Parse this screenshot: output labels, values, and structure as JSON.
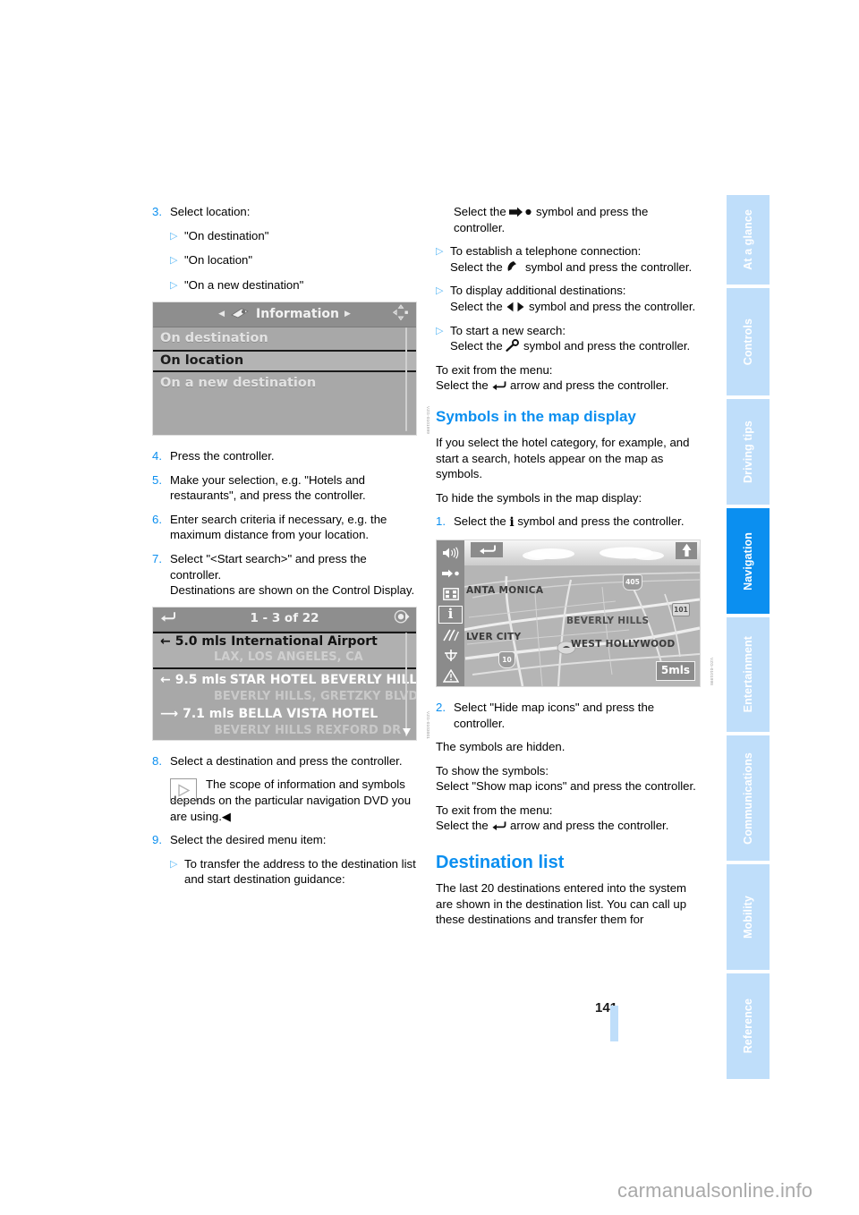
{
  "document": {
    "page_number": "141",
    "watermark": "carmanualsonline.info"
  },
  "sidebar": {
    "tabs": [
      {
        "label": "At a glance",
        "active": false
      },
      {
        "label": "Controls",
        "active": false
      },
      {
        "label": "Driving tips",
        "active": false
      },
      {
        "label": "Navigation",
        "active": true
      },
      {
        "label": "Entertainment",
        "active": false
      },
      {
        "label": "Communications",
        "active": false
      },
      {
        "label": "Mobility",
        "active": false
      },
      {
        "label": "Reference",
        "active": false
      }
    ]
  },
  "left_column": {
    "step3": {
      "num": "3.",
      "text": "Select location:",
      "bullets": [
        "\"On destination\"",
        "\"On location\"",
        "\"On a new destination\""
      ]
    },
    "figure_information": {
      "caption": "VZG-0101999",
      "header_title": "Information",
      "rows": [
        {
          "label": "On destination",
          "selected": false
        },
        {
          "label": "On location",
          "selected": true
        },
        {
          "label": "On a new destination",
          "selected": false
        }
      ]
    },
    "step4": {
      "num": "4.",
      "text": "Press the controller."
    },
    "step5": {
      "num": "5.",
      "text": "Make your selection, e.g. \"Hotels and restaurants\", and press the controller."
    },
    "step6": {
      "num": "6.",
      "text": "Enter search criteria if necessary, e.g. the maximum distance from your location."
    },
    "step7": {
      "num": "7.",
      "text": "Select \"<Start search>\" and press the controller.",
      "text2": "Destinations are shown on the Control Display."
    },
    "figure_destinations": {
      "caption": "VZG-0103001",
      "header_title": "1 - 3 of 22",
      "items": [
        {
          "dir": "left",
          "distance": "5.0 mls",
          "name": "International Airport",
          "address": "LAX, LOS ANGELES, CA",
          "selected": true
        },
        {
          "dir": "left",
          "distance": "9.5 mls",
          "name": "STAR HOTEL BEVERLY HILLS",
          "address": "BEVERLY HILLS, GRETZKY BLVD",
          "selected": false
        },
        {
          "dir": "right",
          "distance": "7.1 mls",
          "name": "BELLA VISTA HOTEL",
          "address": "BEVERLY HILLS REXFORD DR",
          "selected": false
        }
      ]
    },
    "step8": {
      "num": "8.",
      "text": "Select a destination and press the controller."
    },
    "note": {
      "text": "The scope of information and symbols depends on the particular navigation DVD you are using.",
      "end_mark": "◀"
    },
    "step9": {
      "num": "9.",
      "text": "Select the desired menu item:",
      "bullets": [
        "To transfer the address to the destination list and start destination guidance:"
      ]
    }
  },
  "right_column": {
    "cont_text_a": "Select the",
    "cont_text_b": "symbol and press the controller.",
    "bullet_phone": {
      "line1": "To establish a telephone connection:",
      "line2a": "Select the",
      "line2b": "symbol and press the controller."
    },
    "bullet_additional": {
      "line1": "To display additional destinations:",
      "line2a": "Select the",
      "line2b": "symbol and press the controller."
    },
    "bullet_newsearch": {
      "line1": "To start a new search:",
      "line2a": "Select the",
      "line2b": "symbol and press the controller."
    },
    "exit_menu": {
      "line1": "To exit from the menu:",
      "line2a": "Select the",
      "line2b": "arrow and press the controller."
    },
    "heading_symbols": "Symbols in the map display",
    "symbols_intro": "If you select the hotel category, for example, and start a search, hotels appear on the map as symbols.",
    "hide_intro": "To hide the symbols in the map display:",
    "step1": {
      "num": "1.",
      "text_a": "Select the",
      "text_b": "symbol and press the controller."
    },
    "figure_map": {
      "caption": "VZG-0101998",
      "scale": "5mls",
      "cities": [
        {
          "label": "ANTA MONICA"
        },
        {
          "label": "BEVERLY HILLS"
        },
        {
          "label": "LVER CITY"
        },
        {
          "label": "WEST HOLLYWOOD"
        }
      ],
      "shields": [
        {
          "label": "405",
          "type": "us"
        },
        {
          "label": "101",
          "type": "ca"
        },
        {
          "label": "10",
          "type": "i10"
        }
      ],
      "icons": [
        "volume-icon",
        "route-icon",
        "split-screen-icon",
        "info-icon",
        "map-view-icon",
        "traffic-icon",
        "warning-icon"
      ]
    },
    "step2": {
      "num": "2.",
      "text": "Select \"Hide map icons\" and press the controller."
    },
    "hidden_note": "The symbols are hidden.",
    "show_symbols": {
      "line1": "To show the symbols:",
      "line2": "Select \"Show map icons\" and press the controller."
    },
    "exit_menu2": {
      "line1": "To exit from the menu:",
      "line2a": "Select the",
      "line2b": "arrow and press the controller."
    },
    "heading_destination_list": "Destination list",
    "destination_list_text": "The last 20 destinations entered into the system are shown in the destination list. You can call up these destinations and transfer them for"
  }
}
